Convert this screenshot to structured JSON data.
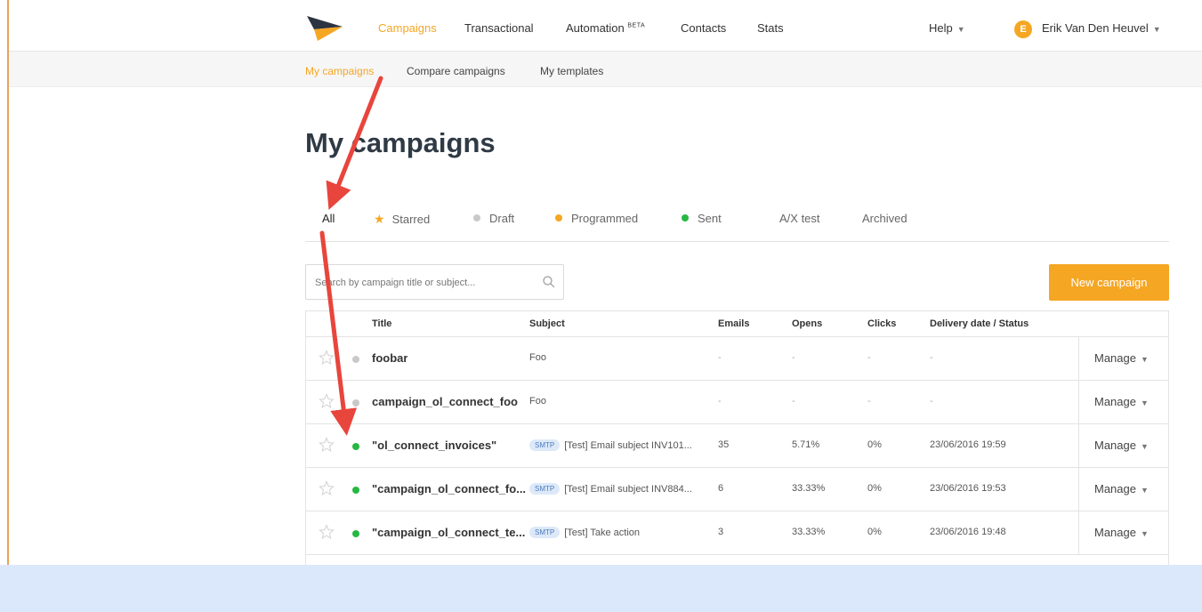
{
  "colors": {
    "accent": "#f5a623",
    "sent": "#27b844",
    "draft": "#c9c9c9",
    "annotation_arrow": "#e8453c"
  },
  "topnav": {
    "items": [
      {
        "label": "Campaigns",
        "active": true
      },
      {
        "label": "Transactional"
      },
      {
        "label": "Automation",
        "badge": "BETA"
      },
      {
        "label": "Contacts"
      },
      {
        "label": "Stats"
      }
    ],
    "help": "Help",
    "user": {
      "initial": "E",
      "name": "Erik Van Den Heuvel"
    }
  },
  "subnav": {
    "items": [
      "My campaigns",
      "Compare campaigns",
      "My templates"
    ]
  },
  "page_title": "My campaigns",
  "filters": [
    "All",
    "Starred",
    "Draft",
    "Programmed",
    "Sent",
    "A/X test",
    "Archived"
  ],
  "search": {
    "placeholder": "Search by campaign title or subject..."
  },
  "new_campaign": "New campaign",
  "table": {
    "headers": [
      "Title",
      "Subject",
      "Emails",
      "Opens",
      "Clicks",
      "Delivery date / Status"
    ],
    "rows": [
      {
        "title": "foobar",
        "subject": "Foo",
        "emails": "-",
        "opens": "-",
        "clicks": "-",
        "date": "-",
        "manage": "Manage"
      },
      {
        "title": "campaign_ol_connect_foo",
        "subject": "Foo",
        "emails": "-",
        "opens": "-",
        "clicks": "-",
        "date": "-",
        "manage": "Manage"
      },
      {
        "title": "\"ol_connect_invoices\"",
        "tag": "SMTP",
        "subject": "[Test] Email subject INV101...",
        "emails": "35",
        "opens": "5.71%",
        "clicks": "0%",
        "date": "23/06/2016 19:59",
        "manage": "Manage"
      },
      {
        "title": "\"campaign_ol_connect_fo...",
        "tag": "SMTP",
        "subject": "[Test] Email subject INV884...",
        "emails": "6",
        "opens": "33.33%",
        "clicks": "0%",
        "date": "23/06/2016 19:53",
        "manage": "Manage"
      },
      {
        "title": "\"campaign_ol_connect_te...",
        "tag": "SMTP",
        "subject": "[Test] Take action",
        "emails": "3",
        "opens": "33.33%",
        "clicks": "0%",
        "date": "23/06/2016 19:48",
        "manage": "Manage"
      }
    ]
  }
}
